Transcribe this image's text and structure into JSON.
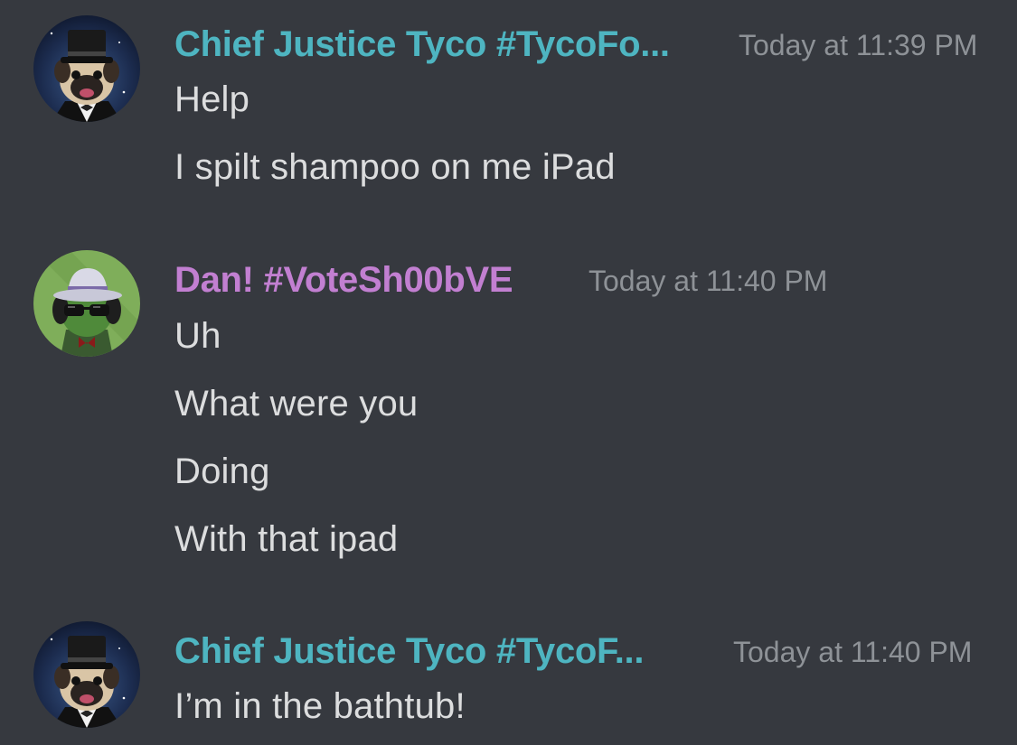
{
  "colors": {
    "background": "#36393f",
    "username_teal": "#4eb5c1",
    "username_purple": "#c27fd1",
    "timestamp": "#8e9297",
    "text": "#dcddde"
  },
  "messages": [
    {
      "avatar": "pug-top-hat-avatar",
      "username": "Chief Justice Tyco #TycoFo...",
      "timestamp": "Today at 11:39 PM",
      "lines": [
        "Help",
        "I spilt shampoo on me iPad"
      ]
    },
    {
      "avatar": "frog-fedora-sunglasses-avatar",
      "username": "Dan! #VoteSh00bVE",
      "timestamp": "Today at 11:40 PM",
      "lines": [
        "Uh",
        "What were you",
        "Doing",
        "With that ipad"
      ]
    },
    {
      "avatar": "pug-top-hat-avatar",
      "username": "Chief Justice Tyco #TycoF...",
      "timestamp": "Today at 11:40 PM",
      "lines": [
        "I’m in the bathtub!"
      ]
    }
  ]
}
